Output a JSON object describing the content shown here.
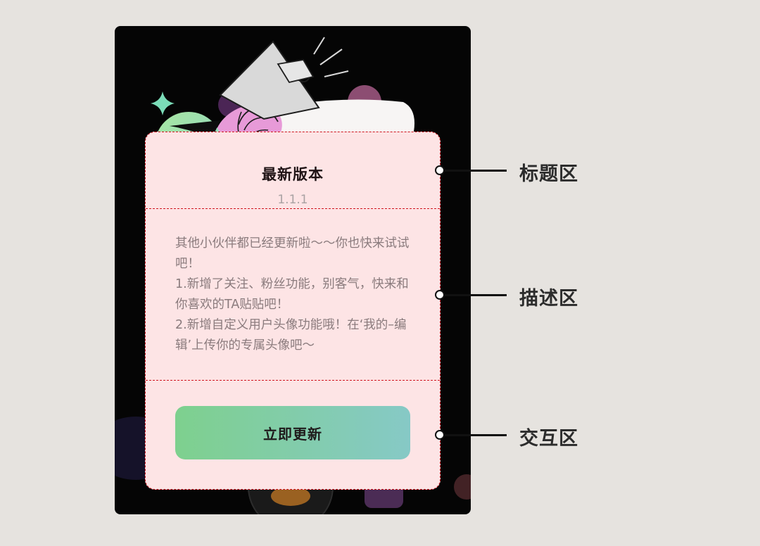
{
  "dialog": {
    "title": "最新版本",
    "version": "1.1.1",
    "description": "其他小伙伴都已经更新啦～～你也快来试试吧！\n1.新增了关注、粉丝功能，别客气，快来和你喜欢的TA贴贴吧！\n2.新增自定义用户头像功能哦！在‘我的–编辑’上传你的专属头像吧～",
    "update_button": "立即更新"
  },
  "annotations": {
    "title_area": "标题区",
    "description_area": "描述区",
    "interaction_area": "交互区"
  },
  "colors": {
    "page_background": "#e6e3df",
    "phone_background": "#050505",
    "dialog_background": "#fde4e5",
    "guide_lines": "#d0141e",
    "button_gradient_start": "#7ed08e",
    "button_gradient_end": "#86c9c6"
  },
  "icons": [
    "megaphone-icon",
    "smiley-face-icon",
    "sparkle-icon",
    "hand-icon"
  ]
}
